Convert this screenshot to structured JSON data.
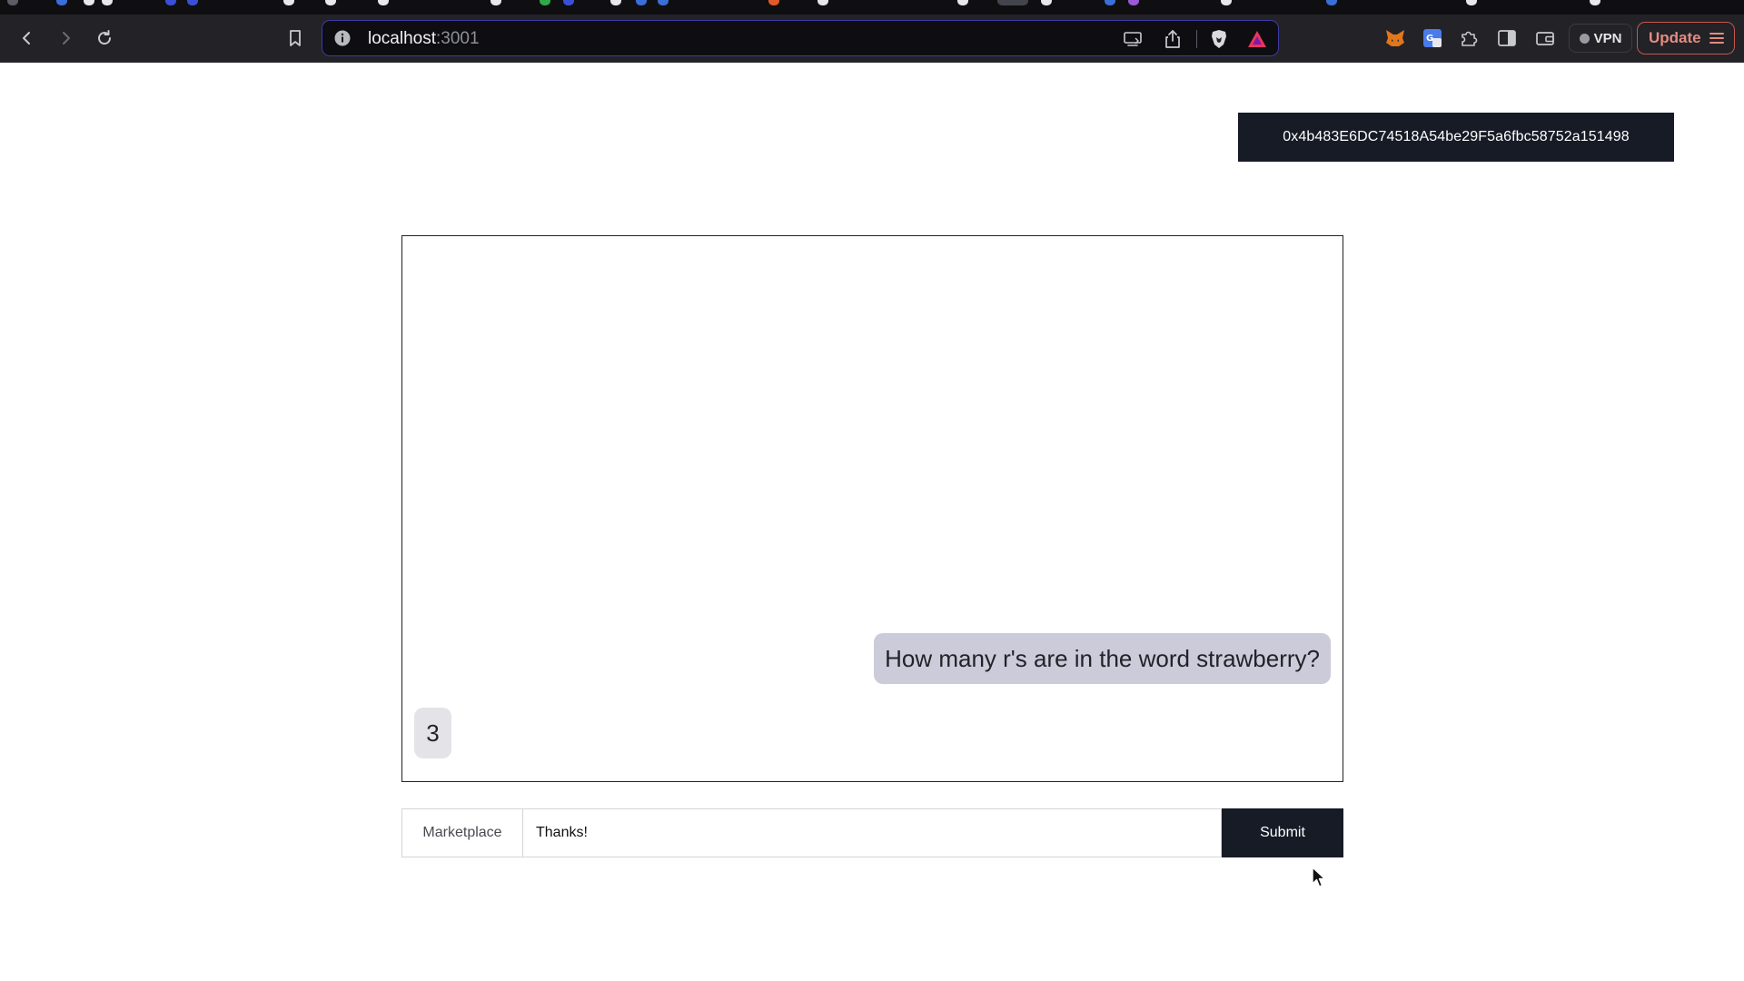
{
  "browser": {
    "url_host": "localhost",
    "url_port": ":3001",
    "vpn_label": "VPN",
    "update_label": "Update"
  },
  "header": {
    "wallet_address": "0x4b483E6DC74518A54be29F5a6fbc58752a151498"
  },
  "chat": {
    "messages": [
      {
        "role": "user",
        "text": "How many r's are in the word strawberry?"
      },
      {
        "role": "assistant",
        "text": "3"
      }
    ]
  },
  "composer": {
    "marketplace_label": "Marketplace",
    "input_value": "Thanks!",
    "submit_label": "Submit"
  },
  "colors": {
    "button_dark": "#161b26",
    "user_bubble": "#cccbd9",
    "assistant_bubble": "#e3e3e8",
    "omnibox_border": "#3d3aa6"
  }
}
